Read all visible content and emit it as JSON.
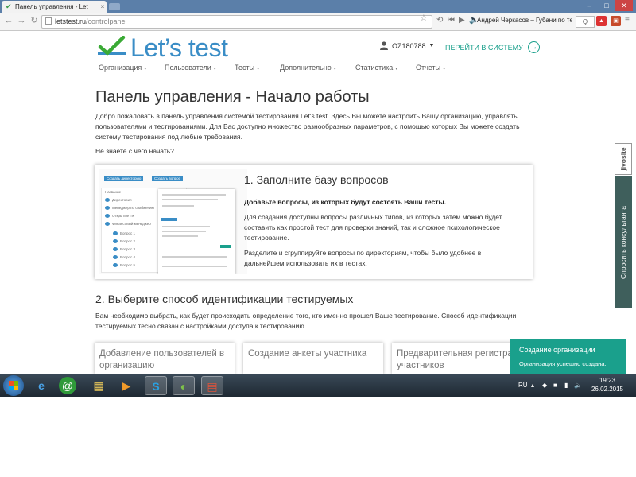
{
  "browser": {
    "tab_title": "Панель управления - Let",
    "tab_close": "×",
    "url_host": "letstest.ru",
    "url_path": "/controlpanel",
    "now_playing": "Андрей Черкасов – Губани по тег",
    "search_label": "Q"
  },
  "site": {
    "logo_text": "Let’s test",
    "user_id": "OZ180788",
    "user_caret": "▼",
    "goto_label": "ПЕРЕЙТИ В СИСТЕМУ",
    "goto_arrow": "→",
    "menu": [
      {
        "label": "Организация"
      },
      {
        "label": "Пользователи"
      },
      {
        "label": "Тесты"
      },
      {
        "label": "Дополнительно"
      },
      {
        "label": "Статистика"
      },
      {
        "label": "Отчеты"
      }
    ],
    "menu_caret": "▾"
  },
  "main": {
    "title": "Панель управления - Начало работы",
    "intro": "Добро пожаловать в панель управления системой тестирования Let's test. Здесь Вы можете настроить Вашу организацию, управлять пользователями и тестированиями. Для Вас доступно множество разнообразных параметров, с помощью которых Вы можете создать систему тестирования под любые требования.",
    "question": "Не знаете с чего начать?",
    "step1": {
      "title": "1. Заполните базу вопросов",
      "bold": "Добавьте вопросы, из которых будут состоять Ваши тесты.",
      "p1": "Для создания доступны вопросы различных типов, из которых затем можно будет составить как простой тест для проверки знаний, так и сложное психологическое тестирование.",
      "p2": "Разделите и сгруппируйте вопросы по директориям, чтобы было удобнее в дальнейшем использовать их в тестах.",
      "shot": {
        "btn1": "Создать директорию",
        "btn2": "Создать вопрос",
        "tree": [
          "Название",
          "Директория",
          "Менеджер по снабжению",
          "Открытые ПК",
          "Финансовый менеджер",
          "Вопрос 1",
          "Вопрос 2",
          "Вопрос 3",
          "Вопрос 4",
          "Вопрос 5"
        ]
      }
    },
    "step2": {
      "title": "2. Выберите способ идентификации тестируемых",
      "desc": "Вам необходимо выбрать, как будет происходить определение того, кто именно прошел Ваше тестирование. Способ идентификации тестируемых тесно связан с настройками доступа к тестированию.",
      "tiles": [
        "Добавление пользователей в организацию",
        "Создание анкеты участника",
        "Предварительная регистрация участников"
      ]
    }
  },
  "widgets": {
    "jivosite": "jivosite",
    "consultant": "Спросить консультанта"
  },
  "toast": {
    "title": "Создание организации",
    "message": "Организация успешно создана."
  },
  "taskbar": {
    "lang": "RU",
    "time": "19:23",
    "date": "26.02.2015"
  }
}
